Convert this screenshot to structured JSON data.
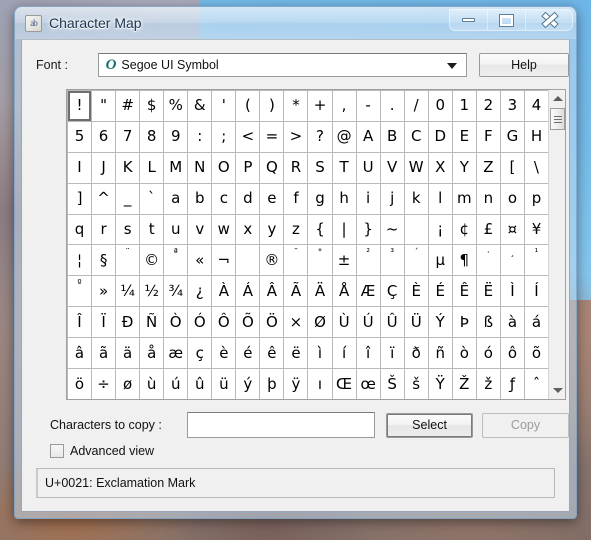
{
  "window": {
    "title": "Character Map",
    "icon": "character-map-icon",
    "caption_buttons": [
      {
        "name": "minimize",
        "label": "Minimize"
      },
      {
        "name": "maximize",
        "label": "Maximize"
      },
      {
        "name": "close",
        "label": "Close"
      }
    ]
  },
  "font_row": {
    "label": "Font :",
    "selected_font": "Segoe UI Symbol",
    "font_type_icon": "O",
    "dropdown_icon": "chevron-down-icon",
    "help_label": "Help"
  },
  "grid": {
    "columns": 20,
    "rows": 11,
    "selected_index": 0,
    "cells": [
      "!",
      "\"",
      "#",
      "$",
      "%",
      "&",
      "'",
      "(",
      ")",
      "*",
      "+",
      ",",
      "-",
      ".",
      "/",
      "0",
      "1",
      "2",
      "3",
      "4",
      "5",
      "6",
      "7",
      "8",
      "9",
      ":",
      ";",
      "<",
      "=",
      ">",
      "?",
      "@",
      "A",
      "B",
      "C",
      "D",
      "E",
      "F",
      "G",
      "H",
      "I",
      "J",
      "K",
      "L",
      "M",
      "N",
      "O",
      "P",
      "Q",
      "R",
      "S",
      "T",
      "U",
      "V",
      "W",
      "X",
      "Y",
      "Z",
      "[",
      "\\",
      "]",
      "^",
      "_",
      "`",
      "a",
      "b",
      "c",
      "d",
      "e",
      "f",
      "g",
      "h",
      "i",
      "j",
      "k",
      "l",
      "m",
      "n",
      "o",
      "p",
      "q",
      "r",
      "s",
      "t",
      "u",
      "v",
      "w",
      "x",
      "y",
      "z",
      "{",
      "|",
      "}",
      "~",
      " ",
      "¡",
      "¢",
      "£",
      "¤",
      "¥",
      "¦",
      "§",
      "¨",
      "©",
      "ª",
      "«",
      "¬",
      "­",
      "®",
      "¯",
      "°",
      "±",
      "²",
      "³",
      "´",
      "µ",
      "¶",
      "·",
      "¸",
      "¹",
      "º",
      "»",
      "¼",
      "½",
      "¾",
      "¿",
      "À",
      "Á",
      "Â",
      "Ã",
      "Ä",
      "Å",
      "Æ",
      "Ç",
      "È",
      "É",
      "Ê",
      "Ë",
      "Ì",
      "Í",
      "Î",
      "Ï",
      "Ð",
      "Ñ",
      "Ò",
      "Ó",
      "Ô",
      "Õ",
      "Ö",
      "×",
      "Ø",
      "Ù",
      "Ú",
      "Û",
      "Ü",
      "Ý",
      "Þ",
      "ß",
      "à",
      "á",
      "â",
      "ã",
      "ä",
      "å",
      "æ",
      "ç",
      "è",
      "é",
      "ê",
      "ë",
      "ì",
      "í",
      "î",
      "ï",
      "ð",
      "ñ",
      "ò",
      "ó",
      "ô",
      "õ",
      "ö",
      "÷",
      "ø",
      "ù",
      "ú",
      "û",
      "ü",
      "ý",
      "þ",
      "ÿ",
      "ı",
      "Œ",
      "œ",
      "Š",
      "š",
      "Ÿ",
      "Ž",
      "ž",
      "ƒ",
      "ˆ"
    ]
  },
  "scrollbar": {
    "up_icon": "triangle-up-icon",
    "down_icon": "triangle-down-icon",
    "thumb_icon": "scroll-thumb-grip-icon"
  },
  "bottom": {
    "copy_label": "Characters to copy :",
    "copy_value": "",
    "copy_placeholder": "",
    "select_label": "Select",
    "copy_button_label": "Copy",
    "advanced_label": "Advanced view",
    "advanced_checked": false
  },
  "status": {
    "text": "U+0021: Exclamation Mark"
  },
  "colors": {
    "accent": "#6fb6e8",
    "client_bg": "#f0f0f0",
    "grid_bg": "#ffffff",
    "grid_line": "#b9b9b9",
    "font_icon": "#14706a"
  }
}
